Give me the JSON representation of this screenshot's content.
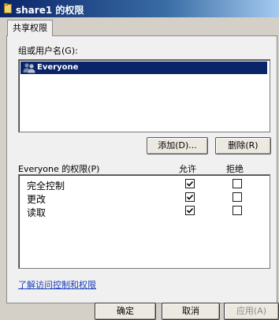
{
  "window": {
    "title": "share1 的权限"
  },
  "tabs": [
    {
      "label": "共享权限"
    }
  ],
  "users": {
    "label": "组或用户名(G):",
    "items": [
      {
        "name": "Everyone",
        "selected": true
      }
    ],
    "add_button": "添加(D)...",
    "remove_button": "删除(R)"
  },
  "permissions": {
    "header": "Everyone 的权限(P)",
    "allow_label": "允许",
    "deny_label": "拒绝",
    "rows": [
      {
        "name": "完全控制",
        "allow": true,
        "deny": false
      },
      {
        "name": "更改",
        "allow": true,
        "deny": false
      },
      {
        "name": "读取",
        "allow": true,
        "deny": false
      }
    ]
  },
  "link": {
    "text": "了解访问控制和权限"
  },
  "footer": {
    "ok_button": "确定",
    "cancel_button": "取消",
    "apply_button": "应用(A)"
  },
  "colors": {
    "selection": "#0a246a",
    "link": "#1c3fb8",
    "dialog_bg": "#d4d0c8"
  },
  "icons": {
    "title": "folder-icon",
    "user": "users-icon",
    "check": "checkmark-icon"
  }
}
